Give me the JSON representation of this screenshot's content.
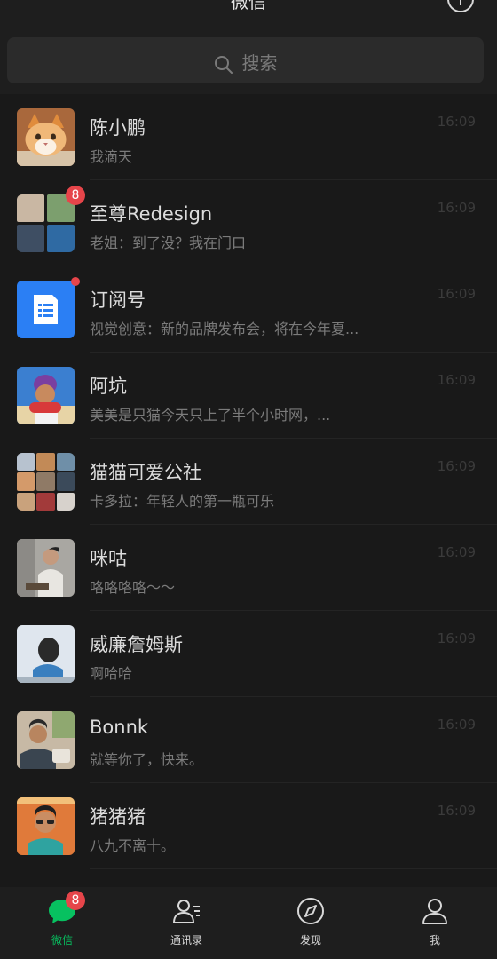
{
  "header": {
    "title": "微信",
    "add_icon": "add-circle-icon"
  },
  "search": {
    "placeholder": "搜索",
    "icon": "search-icon"
  },
  "chats": [
    {
      "name": "陈小鹏",
      "preview": "我滴天",
      "time": "16:09",
      "avatar": "cat-photo"
    },
    {
      "name": "至尊Redesign",
      "preview": "老姐：到了没？我在门口",
      "time": "16:09",
      "avatar": "group-4",
      "badge": "8"
    },
    {
      "name": "订阅号",
      "preview": "视觉创意：新的品牌发布会，将在今年夏...",
      "time": "16:09",
      "avatar": "subscription-icon",
      "dot": true
    },
    {
      "name": "阿坑",
      "preview": "美美是只猫今天只上了半个小时网，...",
      "time": "16:09",
      "avatar": "person-photo"
    },
    {
      "name": "猫猫可爱公社",
      "preview": "卡多拉：年轻人的第一瓶可乐",
      "time": "16:09",
      "avatar": "group-9"
    },
    {
      "name": "咪咕",
      "preview": "咯咯咯咯～～",
      "time": "16:09",
      "avatar": "person-photo"
    },
    {
      "name": "威廉詹姆斯",
      "preview": "啊哈哈",
      "time": "16:09",
      "avatar": "person-photo"
    },
    {
      "name": "Bonnk",
      "preview": "就等你了，快来。",
      "time": "16:09",
      "avatar": "person-photo"
    },
    {
      "name": "猪猪猪",
      "preview": "八九不离十。",
      "time": "16:09",
      "avatar": "person-photo"
    }
  ],
  "tabs": [
    {
      "label": "微信",
      "icon": "chat-bubble-icon",
      "active": true,
      "badge": "8"
    },
    {
      "label": "通讯录",
      "icon": "contacts-icon",
      "active": false
    },
    {
      "label": "发现",
      "icon": "compass-icon",
      "active": false
    },
    {
      "label": "我",
      "icon": "person-icon",
      "active": false
    }
  ],
  "colors": {
    "background": "#191919",
    "bar": "#1e1e1e",
    "accent": "#07c160",
    "badge": "#e6454a",
    "subscription": "#2b7ff4"
  }
}
